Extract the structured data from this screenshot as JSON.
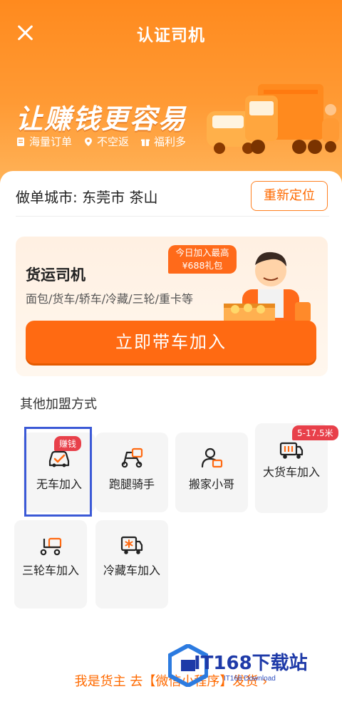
{
  "header": {
    "title": "认证司机",
    "slogan": "让赚钱更容易",
    "features": [
      "海量订单",
      "不空返",
      "福利多"
    ]
  },
  "city": {
    "text": "做单城市: 东莞市 茶山",
    "relocate_label": "重新定位"
  },
  "driver": {
    "title": "货运司机",
    "subtitle": "面包/货车/轿车/冷藏/三轮/重卡等",
    "bonus_line1": "今日加入最高",
    "bonus_line2": "¥688礼包",
    "join_label": "立即带车加入"
  },
  "other": {
    "title": "其他加盟方式",
    "tiles": [
      {
        "label": "无车加入",
        "badge": "赚钱",
        "icon": "car-check-icon"
      },
      {
        "label": "跑腿骑手",
        "icon": "scooter-icon"
      },
      {
        "label": "搬家小哥",
        "icon": "mover-icon"
      },
      {
        "label": "大货车加入",
        "badge": "5-17.5米",
        "icon": "big-truck-icon"
      },
      {
        "label": "三轮车加入",
        "icon": "tricycle-icon"
      },
      {
        "label": "冷藏车加入",
        "icon": "cold-truck-icon"
      }
    ]
  },
  "bottom_link": "我是货主 去【微信小程序】发货 ›",
  "watermark": {
    "text": "IT168下载站",
    "sub": "IT168 Download"
  },
  "colors": {
    "accent": "#ff6a12",
    "badge_red": "#e8404a",
    "highlight": "#3b59d6"
  }
}
